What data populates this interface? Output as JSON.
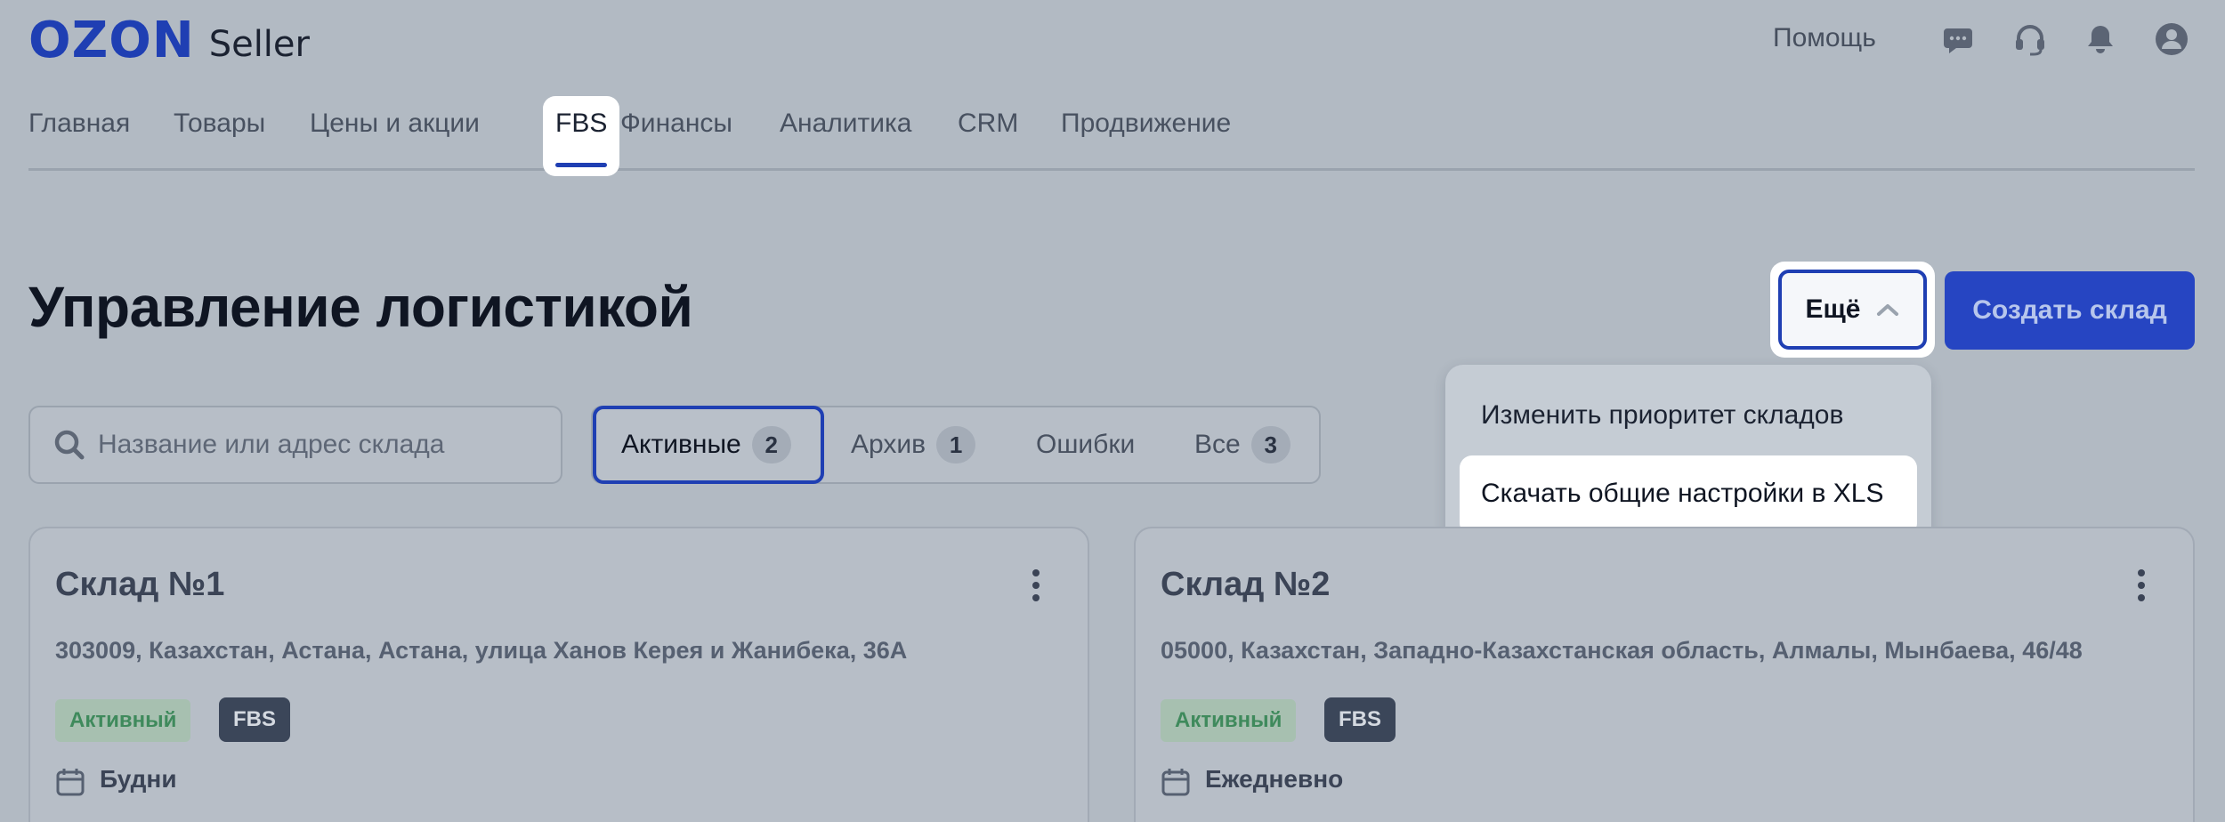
{
  "header": {
    "logo_brand": "OZON",
    "logo_product": "Seller",
    "help_label": "Помощь",
    "icons": [
      "chat-icon",
      "support-headset-icon",
      "bell-icon",
      "user-account-icon"
    ]
  },
  "nav": {
    "items": [
      "Главная",
      "Товары",
      "Цены и акции",
      "FBS",
      "Финансы",
      "Аналитика",
      "CRM",
      "Продвижение"
    ],
    "active": "FBS"
  },
  "page": {
    "title": "Управление логистикой"
  },
  "toolbar": {
    "more_label": "Ещё",
    "create_label": "Создать склад"
  },
  "dropdown": {
    "items": [
      "Изменить приоритет складов",
      "Скачать общие настройки в XLS"
    ],
    "highlighted": "Скачать общие настройки в XLS"
  },
  "search": {
    "placeholder": "Название или адрес склада"
  },
  "filters": {
    "tabs": [
      {
        "label": "Активные",
        "count": "2"
      },
      {
        "label": "Архив",
        "count": "1"
      },
      {
        "label": "Ошибки",
        "count": ""
      },
      {
        "label": "Все",
        "count": "3"
      }
    ],
    "active": "Активные"
  },
  "cards": [
    {
      "title": "Склад №1",
      "address": "303009, Казахстан, Астана, Астана, улица Ханов Керея и Жанибека, 36А",
      "status": "Активный",
      "type": "FBS",
      "schedule": "Будни"
    },
    {
      "title": "Склад №2",
      "address": "05000, Казахстан, Западно-Казахстанская область, Алмалы, Мынбаева, 46/48",
      "status": "Активный",
      "type": "FBS",
      "schedule": "Ежедневно"
    }
  ],
  "colors": {
    "brand": "#1f3fb3",
    "primary_button": "#2645c2",
    "active_status": "#3f8a5c",
    "backdrop": "#b2bac3"
  }
}
